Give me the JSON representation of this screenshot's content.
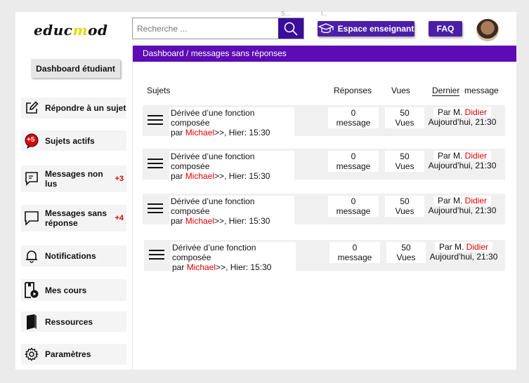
{
  "header": {
    "logo_pre": "educ",
    "logo_m": "m",
    "logo_post": "od",
    "search_placeholder": "Recherche ...",
    "tiny_left": "S....",
    "tiny_right": "I...",
    "teacher_button": "Espace enseignant",
    "faq_button": "FAQ"
  },
  "sidebar": {
    "dashboard_button": "Dashboard étudiant",
    "items": [
      {
        "label": "Répondre à  un sujet",
        "count": ""
      },
      {
        "label": "Sujets actifs",
        "count": "",
        "badge": "+5"
      },
      {
        "label": "Messages non lus",
        "count": "+3"
      },
      {
        "label": "Messages sans réponse",
        "count": "+4"
      },
      {
        "label": "Notifications",
        "count": ""
      },
      {
        "label": "Mes cours",
        "count": ""
      },
      {
        "label": "Ressources",
        "count": ""
      },
      {
        "label": "Paramètres",
        "count": ""
      }
    ]
  },
  "main": {
    "breadcrumb": "Dashboard / messages sans réponses",
    "columns": {
      "subjects": "Sujets",
      "replies": "Réponses",
      "views": "Vues",
      "last_a": "Dernier",
      "last_b": "message"
    },
    "rows": [
      {
        "title": "Dérivée d’une fonction composée",
        "by_pre": "par ",
        "author": "Michael",
        "by_post": ">>, Hier: 15:30",
        "replies_n": "0",
        "replies_l": "message",
        "views_n": "50",
        "views_l": "Vues",
        "last_pre": "Par M. ",
        "last_author": "Didier",
        "last_time": "Aujourd’hui, 21:30"
      },
      {
        "title": "Dérivée d’une fonction composée",
        "by_pre": "par ",
        "author": "Michael",
        "by_post": ">>, Hier: 15:30",
        "replies_n": "0",
        "replies_l": "message",
        "views_n": "50",
        "views_l": "Vues",
        "last_pre": "Par M. ",
        "last_author": "Didier",
        "last_time": "Aujourd’hui, 21:30"
      },
      {
        "title": "Dérivée d’une fonction composée",
        "by_pre": "par ",
        "author": "Michael",
        "by_post": ">>, Hier: 15:30",
        "replies_n": "0",
        "replies_l": "message",
        "views_n": "50",
        "views_l": "Vues",
        "last_pre": "Par M. ",
        "last_author": "Didier",
        "last_time": "Aujourd’hui, 21:30"
      },
      {
        "title": "Dérivée d’une fonction composée",
        "by_pre": "par ",
        "author": "Michael",
        "by_post": ">>, Hier: 15:30",
        "replies_n": "0",
        "replies_l": "message",
        "views_n": "50",
        "views_l": "Vues",
        "last_pre": "Par M. ",
        "last_author": "Didier",
        "last_time": "Aujourd’hui, 21:30"
      }
    ]
  },
  "colors": {
    "accent": "#5d0bb4",
    "button": "#4b1ea8",
    "highlight": "#e00000",
    "logo_m": "#e8d800"
  }
}
